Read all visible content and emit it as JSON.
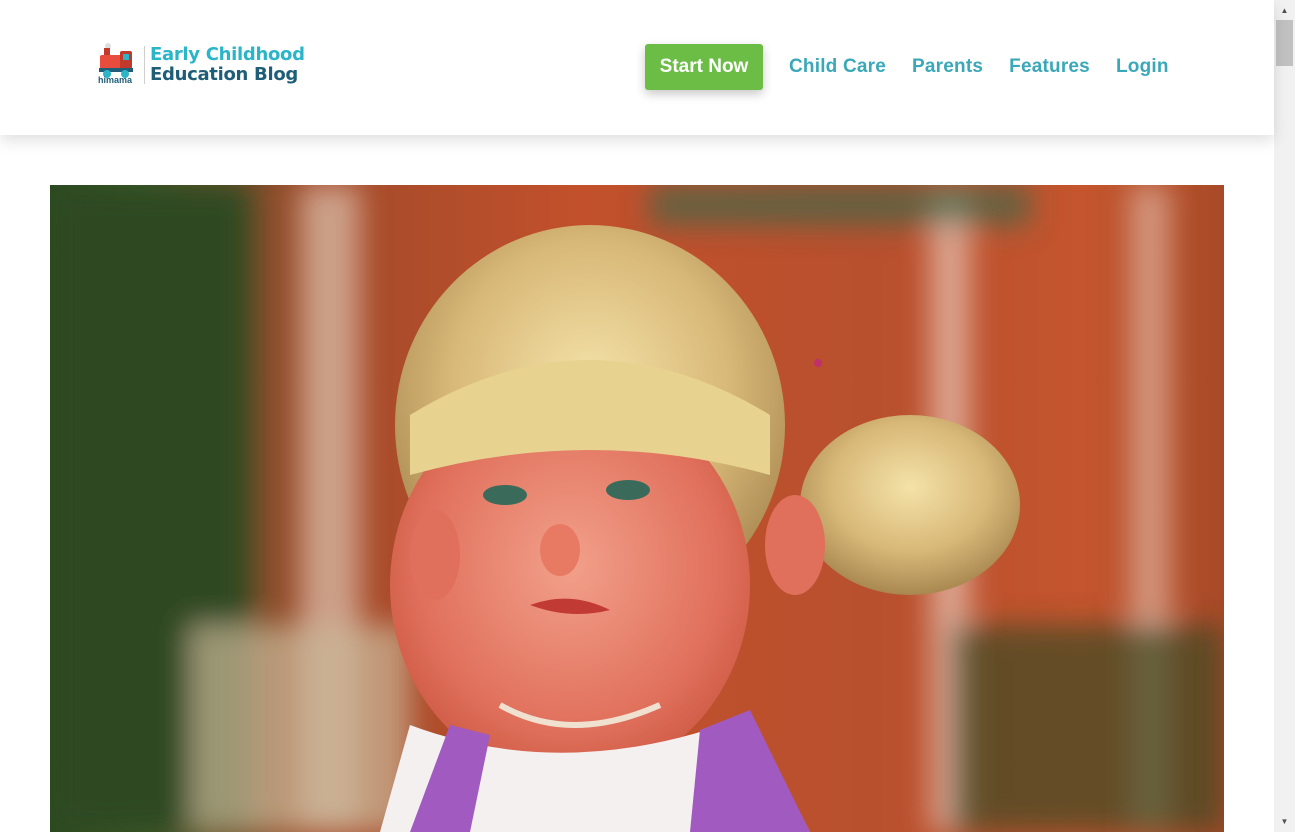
{
  "brand": {
    "line1": "Early Childhood",
    "line2": "Education Blog",
    "sub": "himama",
    "logo_icon": "train-icon",
    "colors": {
      "line1": "#2bb5c9",
      "line2": "#1f5e78"
    }
  },
  "nav": {
    "start_label": "Start Now",
    "links": [
      {
        "label": "Child Care"
      },
      {
        "label": "Parents"
      },
      {
        "label": "Features"
      },
      {
        "label": "Login"
      }
    ],
    "colors": {
      "start_bg": "#6cbd45",
      "link": "#3aa8b8"
    }
  },
  "hero": {
    "image_subject": "crying-toddler-photo"
  },
  "scrollbar": {
    "up_icon": "triangle-up-icon",
    "down_icon": "triangle-down-icon"
  }
}
